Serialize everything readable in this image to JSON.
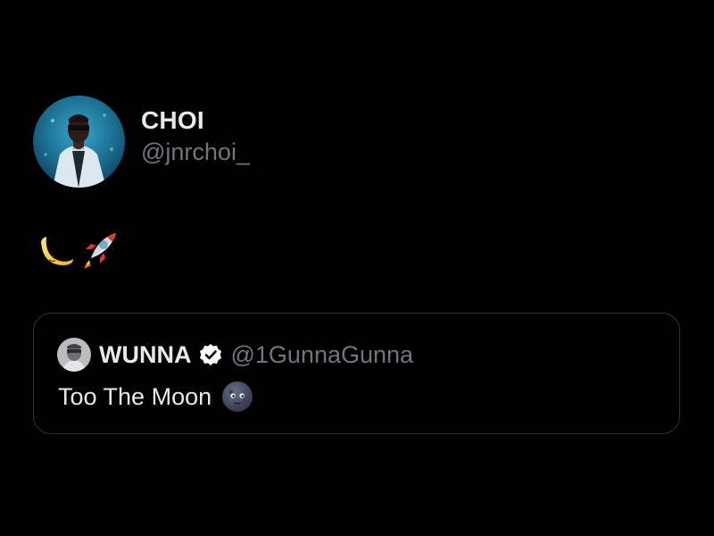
{
  "tweet": {
    "author": {
      "display_name": "CHOI",
      "handle": "@jnrchoi_",
      "avatar_icon": "profile-photo-avatar"
    },
    "body": {
      "emojis": [
        "crescent-moon-emoji",
        "rocket-emoji"
      ]
    },
    "quoted_tweet": {
      "display_name": "WUNNA",
      "handle": "@1GunnaGunna",
      "verified_icon": "verified-badge-icon",
      "text": "Too The Moon",
      "trailing_emoji": "new-moon-face-emoji",
      "avatar_icon": "profile-photo-avatar"
    }
  },
  "colors": {
    "background": "#000000",
    "primary_text": "#e7e9ea",
    "secondary_text": "#71767b",
    "border": "#2f3336"
  }
}
